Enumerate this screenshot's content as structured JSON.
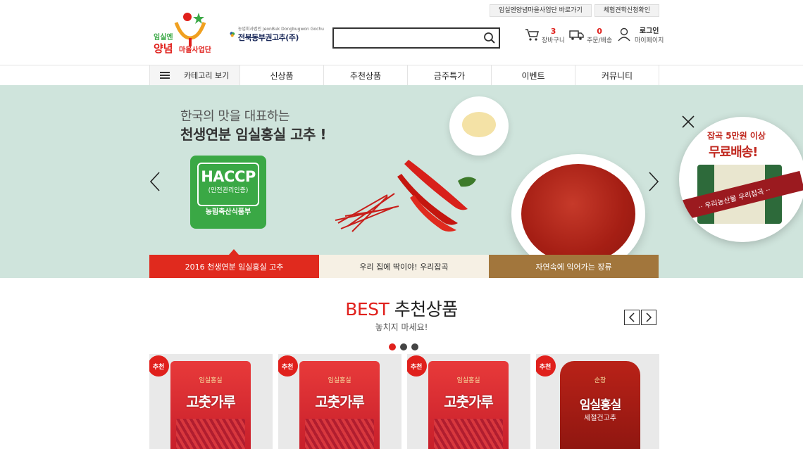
{
  "header": {
    "top_links": [
      "임실엔양념마을사업단 바로가기",
      "체험견학신청확인"
    ],
    "logo1": {
      "line1": "임실엔",
      "line2": "양념",
      "line3": "마을사업단"
    },
    "logo2": {
      "small": "농업회사법인 JeonBuk Dongbugwon Gochu",
      "big": "전북동부권고추(주)"
    },
    "search": {
      "placeholder": "",
      "value": ""
    },
    "cart": {
      "count": "3",
      "label": "장바구니"
    },
    "orders": {
      "count": "0",
      "label": "주문/배송"
    },
    "account": {
      "login": "로그인",
      "mypage": "마이페이지"
    }
  },
  "nav": {
    "category_label": "카테고리 보기",
    "items": [
      "신상품",
      "추천상품",
      "금주특가",
      "이벤트",
      "커뮤니티"
    ]
  },
  "banner": {
    "subtitle": "한국의 맛을 대표하는",
    "title": "천생연분 임실홍실 고추 !",
    "haccp": {
      "title": "HACCP",
      "sub": "(안전관리인증)",
      "ministry": "농림축산식품부"
    },
    "tabs": [
      "2016 천생연분 임실홍실 고추",
      "우리 집에 딱이야! 우리잡곡",
      "자연속에 익어가는 장류"
    ]
  },
  "promo": {
    "line1": "잡곡 5만원 이상",
    "line2": "무료배송!",
    "ribbon": "·· 우리농산물 우리잡곡 ··"
  },
  "best": {
    "title_accent": "BEST",
    "title_rest": "추천상품",
    "subtitle": "놓치지 마세요!",
    "dots_count": 3,
    "active_dot": 0
  },
  "products": [
    {
      "badge": "추천",
      "bag_sub": "임실홍실",
      "bag_name": "고춧가루"
    },
    {
      "badge": "추천",
      "bag_sub": "임실홍실",
      "bag_name": "고춧가루"
    },
    {
      "badge": "추천",
      "bag_sub": "임실홍실",
      "bag_name": "고춧가루"
    },
    {
      "badge": "추천",
      "bag_sub": "순창",
      "bag_name": "임실홍실",
      "bag_sub2": "세절건고추"
    }
  ],
  "colors": {
    "accent_red": "#e0201c",
    "banner_bg": "#cfe4dc",
    "haccp_green": "#3aa845",
    "tab_brown": "#a2763c",
    "tab_cream": "#f6f0e4"
  }
}
